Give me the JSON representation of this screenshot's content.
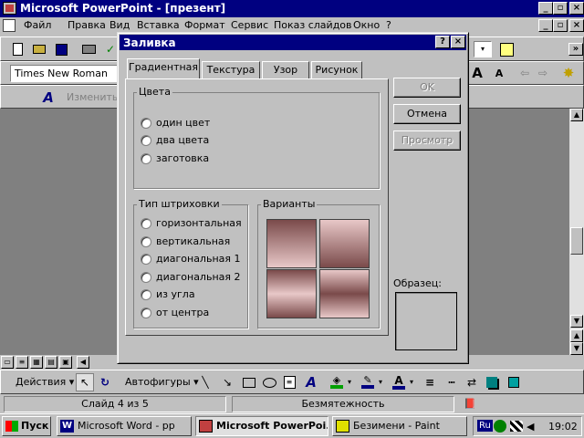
{
  "app": {
    "title": "Microsoft PowerPoint - [презент]",
    "menu": [
      "Файл",
      "Правка",
      "Вид",
      "Вставка",
      "Формат",
      "Сервис",
      "Показ слайдов",
      "Окно",
      "?"
    ],
    "font_name": "Times New Roman",
    "outline_label": "Изменить"
  },
  "dialog": {
    "title": "Заливка",
    "help_btn": "?",
    "close_btn": "×",
    "tabs": [
      "Градиентная",
      "Текстура",
      "Узор",
      "Рисунок"
    ],
    "colors_group": "Цвета",
    "color_options": [
      "один цвет",
      "два цвета",
      "заготовка"
    ],
    "hatch_group": "Тип штриховки",
    "hatch_options": [
      "горизонтальная",
      "вертикальная",
      "диагональная 1",
      "диагональная 2",
      "из угла",
      "от центра"
    ],
    "variants_group": "Варианты",
    "ok": "OK",
    "cancel": "Отмена",
    "preview": "Просмотр",
    "sample_label": "Образец:",
    "gradient_colors": {
      "light": "#e8c8c8",
      "dark": "#7a4a4a"
    }
  },
  "drawing_toolbar": {
    "actions": "Действия",
    "autoshapes": "Автофигуры"
  },
  "status": {
    "slide": "Слайд 4 из 5",
    "template": "Безмятежность"
  },
  "taskbar": {
    "start": "Пуск",
    "tasks": [
      "Microsoft Word - pp",
      "Microsoft PowerPoi...",
      "Безимени - Paint"
    ],
    "lang": "Ru",
    "clock": "19:02"
  }
}
